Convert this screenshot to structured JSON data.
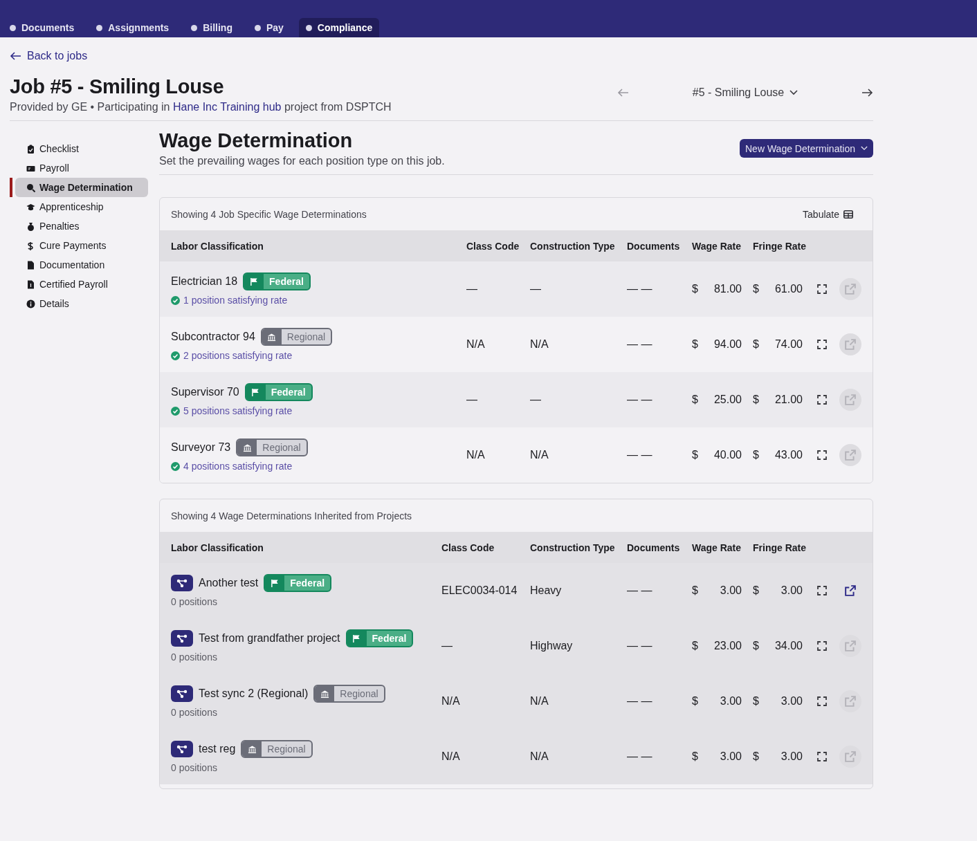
{
  "nav_tabs": [
    {
      "label": "Documents",
      "selected": false
    },
    {
      "label": "Assignments",
      "selected": false
    },
    {
      "label": "Billing",
      "selected": false
    },
    {
      "label": "Pay",
      "selected": false
    },
    {
      "label": "Compliance",
      "selected": true
    }
  ],
  "back_link": "Back to jobs",
  "job": {
    "title": "Job #5 - Smiling Louse",
    "subtitle_before": "Provided by GE • Participating in ",
    "subtitle_link": "Hane Inc Training hub",
    "subtitle_after": " project from DSPTCH"
  },
  "job_switcher": {
    "label": "#5 - Smiling Louse",
    "prev_disabled": true,
    "next_disabled": false
  },
  "sidebar": {
    "items": [
      {
        "label": "Checklist",
        "selected": false
      },
      {
        "label": "Payroll",
        "selected": false
      },
      {
        "label": "Wage Determination",
        "selected": true
      },
      {
        "label": "Apprenticeship",
        "selected": false
      },
      {
        "label": "Penalties",
        "selected": false
      },
      {
        "label": "Cure Payments",
        "selected": false
      },
      {
        "label": "Documentation",
        "selected": false
      },
      {
        "label": "Certified Payroll",
        "selected": false
      },
      {
        "label": "Details",
        "selected": false
      }
    ]
  },
  "section": {
    "title": "Wage Determination",
    "description": "Set the prevailing wages for each position type on this job.",
    "new_button": "New Wage Determination"
  },
  "tables": [
    {
      "kind": "job",
      "caption": "Showing 4 Job Specific Wage Determinations",
      "tabulate": "Tabulate",
      "columns": [
        "Labor Classification",
        "Class Code",
        "Construction Type",
        "Documents",
        "Wage Rate",
        "Fringe Rate"
      ],
      "rows": [
        {
          "classification": "Electrician 18",
          "badge": {
            "kind": "federal",
            "label": "Federal"
          },
          "note": "1 position satisfying rate",
          "class_code": "—",
          "construction_type": "—",
          "documents": "— —",
          "wage_currency": "$",
          "wage": "81.00",
          "fringe_currency": "$",
          "fringe": "61.00",
          "export_enabled": false
        },
        {
          "classification": "Subcontractor 94",
          "badge": {
            "kind": "regional",
            "label": "Regional"
          },
          "note": "2 positions satisfying rate",
          "class_code": "N/A",
          "construction_type": "N/A",
          "documents": "— —",
          "wage_currency": "$",
          "wage": "94.00",
          "fringe_currency": "$",
          "fringe": "74.00",
          "export_enabled": false
        },
        {
          "classification": "Supervisor 70",
          "badge": {
            "kind": "federal",
            "label": "Federal"
          },
          "note": "5 positions satisfying rate",
          "class_code": "—",
          "construction_type": "—",
          "documents": "— —",
          "wage_currency": "$",
          "wage": "25.00",
          "fringe_currency": "$",
          "fringe": "21.00",
          "export_enabled": false
        },
        {
          "classification": "Surveyor 73",
          "badge": {
            "kind": "regional",
            "label": "Regional"
          },
          "note": "4 positions satisfying rate",
          "class_code": "N/A",
          "construction_type": "N/A",
          "documents": "— —",
          "wage_currency": "$",
          "wage": "40.00",
          "fringe_currency": "$",
          "fringe": "43.00",
          "export_enabled": false
        }
      ]
    },
    {
      "kind": "project",
      "caption": "Showing 4 Wage Determinations Inherited from Projects",
      "columns": [
        "Labor Classification",
        "Class Code",
        "Construction Type",
        "Documents",
        "Wage Rate",
        "Fringe Rate"
      ],
      "rows": [
        {
          "classification": "Another test",
          "badge": {
            "kind": "federal",
            "label": "Federal"
          },
          "note": "0 positions",
          "class_code": "ELEC0034-014",
          "construction_type": "Heavy",
          "documents": "— —",
          "wage_currency": "$",
          "wage": "3.00",
          "fringe_currency": "$",
          "fringe": "3.00",
          "export_enabled": true
        },
        {
          "classification": "Test from grandfather project",
          "badge": {
            "kind": "federal",
            "label": "Federal"
          },
          "note": "0 positions",
          "class_code": "—",
          "construction_type": "Highway",
          "documents": "— —",
          "wage_currency": "$",
          "wage": "23.00",
          "fringe_currency": "$",
          "fringe": "34.00",
          "export_enabled": false
        },
        {
          "classification": "Test sync 2 (Regional)",
          "badge": {
            "kind": "regional",
            "label": "Regional"
          },
          "note": "0 positions",
          "class_code": "N/A",
          "construction_type": "N/A",
          "documents": "— —",
          "wage_currency": "$",
          "wage": "3.00",
          "fringe_currency": "$",
          "fringe": "3.00",
          "export_enabled": false
        },
        {
          "classification": "test reg",
          "badge": {
            "kind": "regional",
            "label": "Regional"
          },
          "note": "0 positions",
          "class_code": "N/A",
          "construction_type": "N/A",
          "documents": "— —",
          "wage_currency": "$",
          "wage": "3.00",
          "fringe_currency": "$",
          "fringe": "3.00",
          "export_enabled": false
        }
      ]
    }
  ]
}
